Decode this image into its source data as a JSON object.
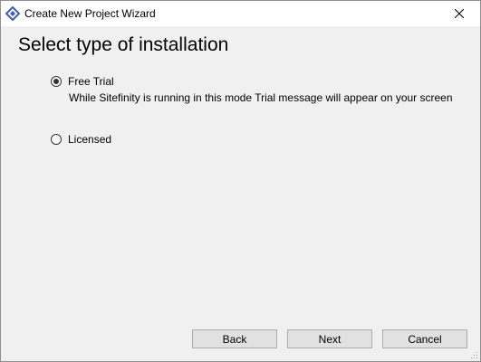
{
  "window": {
    "title": "Create New Project Wizard",
    "app_icon": "sitefinity-logo-icon",
    "close_icon": "close-icon"
  },
  "page": {
    "heading": "Select type of installation"
  },
  "options": [
    {
      "label": "Free Trial",
      "selected": true,
      "description": "While Sitefinity is running in this mode Trial message will appear on your screen"
    },
    {
      "label": "Licensed",
      "selected": false
    }
  ],
  "buttons": {
    "back": "Back",
    "next": "Next",
    "cancel": "Cancel"
  },
  "colors": {
    "accent": "#3b5fb8",
    "background": "#f0f0f0",
    "button_face": "#e1e1e1"
  }
}
